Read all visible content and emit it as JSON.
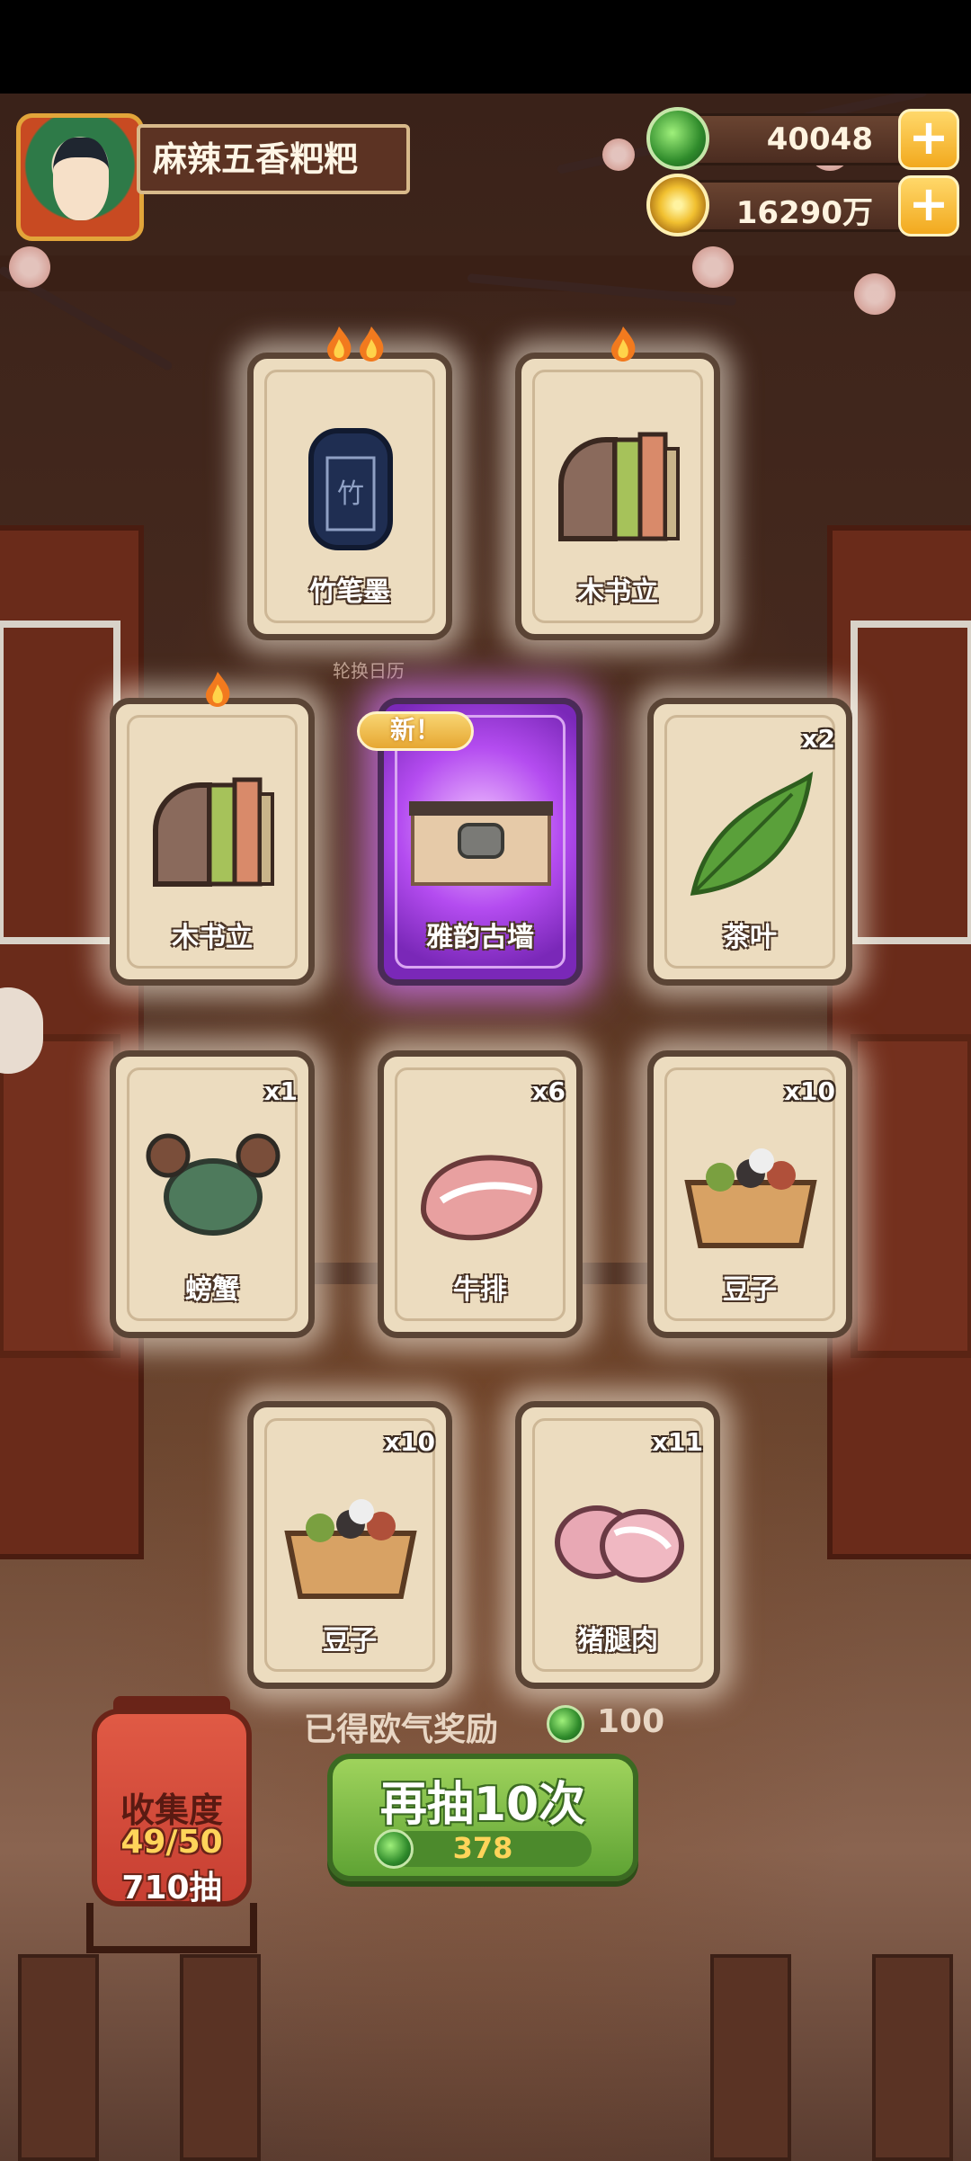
{
  "player": {
    "name": "麻辣五香粑粑",
    "avatar_icon": "character-avatar-icon"
  },
  "currencies": [
    {
      "name": "jade",
      "icon": "jade-coin-icon",
      "value": "40048"
    },
    {
      "name": "gold",
      "icon": "gold-coin-icon",
      "value": "16290万"
    }
  ],
  "hint": "轮换日历",
  "cards": [
    {
      "id": "card-1",
      "name": "竹笔墨",
      "icon": "ink-stone-icon",
      "count": "",
      "flames": 2,
      "rarity": "gold",
      "new": false
    },
    {
      "id": "card-2",
      "name": "木书立",
      "icon": "bookend-icon",
      "count": "",
      "flames": 1,
      "rarity": "gold",
      "new": false
    },
    {
      "id": "card-3",
      "name": "木书立",
      "icon": "bookend-icon",
      "count": "",
      "flames": 1,
      "rarity": "gold",
      "new": false
    },
    {
      "id": "card-4",
      "name": "雅韵古墙",
      "icon": "ancient-wall-icon",
      "count": "",
      "flames": 0,
      "rarity": "purple",
      "new": true,
      "new_label": "新！"
    },
    {
      "id": "card-5",
      "name": "茶叶",
      "icon": "tea-leaf-icon",
      "count": "x2",
      "flames": 0,
      "rarity": "normal",
      "new": false
    },
    {
      "id": "card-6",
      "name": "螃蟹",
      "icon": "crab-icon",
      "count": "x1",
      "flames": 0,
      "rarity": "normal",
      "new": false
    },
    {
      "id": "card-7",
      "name": "牛排",
      "icon": "steak-icon",
      "count": "x6",
      "flames": 0,
      "rarity": "normal",
      "new": false
    },
    {
      "id": "card-8",
      "name": "豆子",
      "icon": "beans-box-icon",
      "count": "x10",
      "flames": 0,
      "rarity": "normal",
      "new": false
    },
    {
      "id": "card-9",
      "name": "豆子",
      "icon": "beans-box-icon",
      "count": "x10",
      "flames": 0,
      "rarity": "normal",
      "new": false
    },
    {
      "id": "card-10",
      "name": "猪腿肉",
      "icon": "pork-leg-icon",
      "count": "x11",
      "flames": 0,
      "rarity": "normal",
      "new": false
    }
  ],
  "reward": {
    "label": "已得欧气奖励",
    "icon": "jade-coin-icon",
    "value": "100"
  },
  "draw_button": {
    "label": "再抽10次",
    "cost_icon": "jade-coin-icon",
    "cost": "378"
  },
  "collection": {
    "title": "收集度",
    "progress": "49/50",
    "draws": "710抽"
  }
}
